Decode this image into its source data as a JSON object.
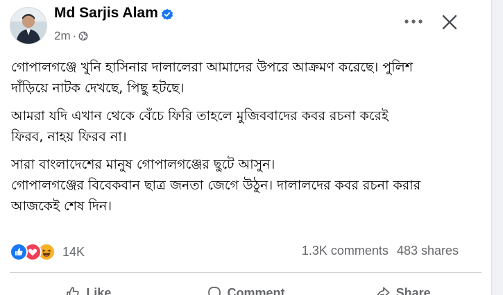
{
  "post": {
    "author_name": "Md Sarjis Alam",
    "verified": true,
    "timestamp": "2m",
    "separator": "·",
    "audience_icon": "globe-icon",
    "paragraphs": [
      "গোপালগঞ্জে খুনি হাসিনার দালালেরা আমাদের উপরে আক্রমণ করেছে। পুলিশ\nদাঁড়িয়ে নাটক দেখছে, পিছু হটছে।",
      "আমরা যদি এখান থেকে বেঁচে ফিরি তাহলে মুজিববাদের কবর রচনা করেই\nফিরব, নাহয় ফিরব না।",
      "সারা বাংলাদেশের মানুষ গোপালগঞ্জের ছুটে আসুন।\nগোপালগঞ্জের বিবেকবান ছাত্র জনতা জেগে উঠুন। দালালদের কবর রচনা করার\nআজকেই শেষ দিন।"
    ]
  },
  "reactions": {
    "icons": [
      "like-icon",
      "love-icon",
      "haha-icon"
    ],
    "count": "14K"
  },
  "stats": {
    "comments": "1.3K comments",
    "shares": "483 shares"
  },
  "actions": {
    "like": "Like",
    "comment": "Comment",
    "share": "Share"
  },
  "colors": {
    "verified_blue": "#1877f2",
    "like_blue": "#1877f2",
    "love_red": "#f33e58",
    "haha_yellow": "#f7b125",
    "secondary_text": "#65676b"
  }
}
